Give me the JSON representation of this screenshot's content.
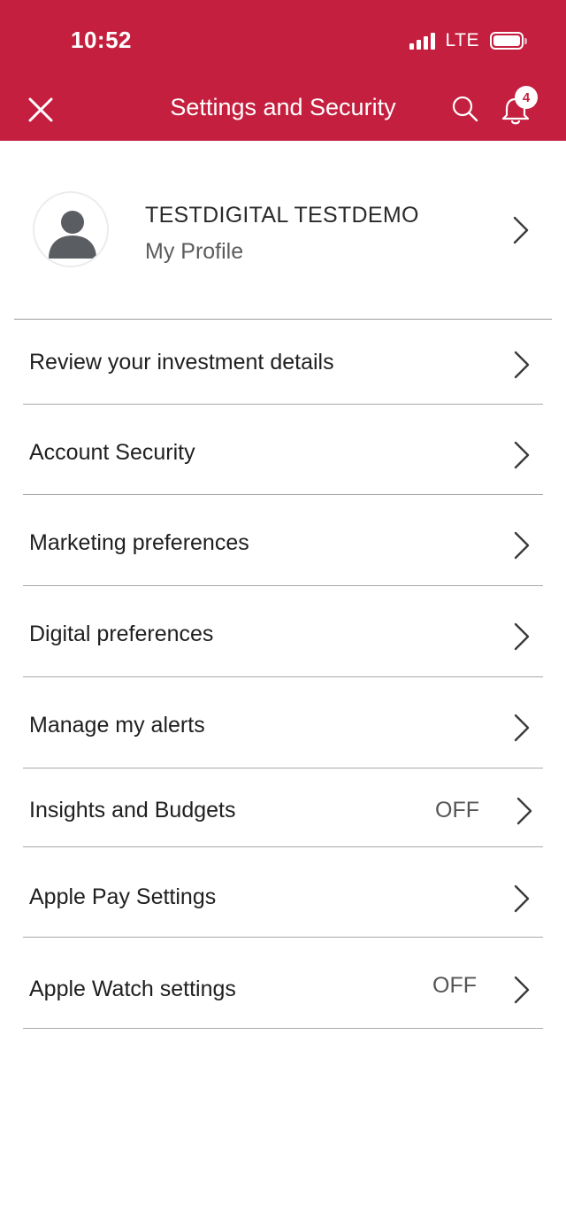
{
  "status_bar": {
    "time": "10:52",
    "network": "LTE"
  },
  "header": {
    "title": "Settings and Security",
    "notification_count": "4",
    "close_icon": "close-icon",
    "search_icon": "search-icon",
    "bell_icon": "bell-icon",
    "background_color": "#c41f3e"
  },
  "profile": {
    "name": "TESTDIGITAL TESTDEMO",
    "subtitle": "My Profile"
  },
  "menu": [
    {
      "label": "Review your investment details",
      "status": ""
    },
    {
      "label": "Account Security",
      "status": ""
    },
    {
      "label": "Marketing preferences",
      "status": ""
    },
    {
      "label": "Digital preferences",
      "status": ""
    },
    {
      "label": "Manage my alerts",
      "status": ""
    },
    {
      "label": "Insights and Budgets",
      "status": "OFF"
    },
    {
      "label": "Apple Pay Settings",
      "status": ""
    },
    {
      "label": "Apple Watch settings",
      "status": "OFF"
    }
  ]
}
